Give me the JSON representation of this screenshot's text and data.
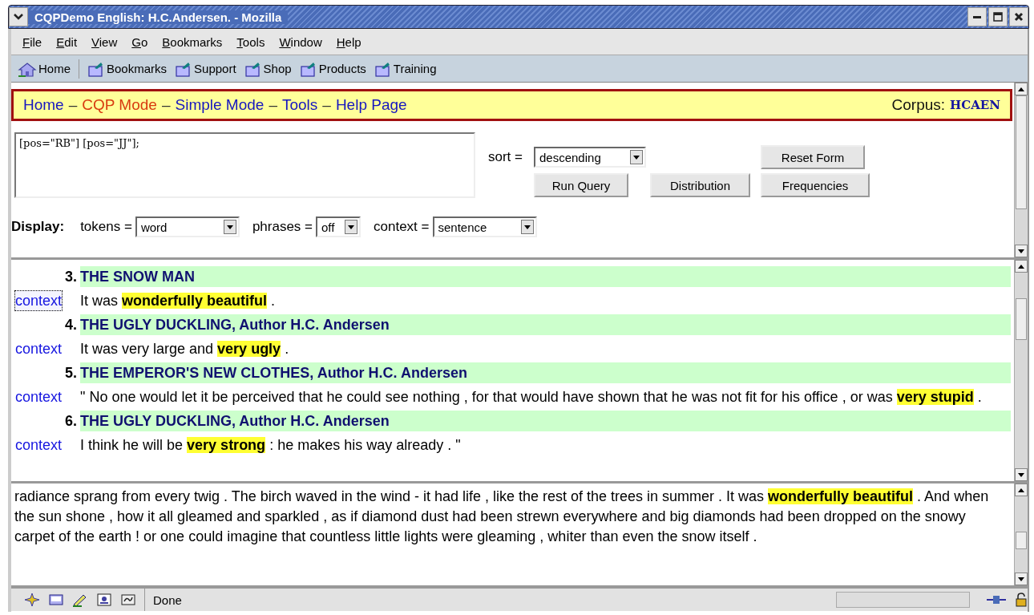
{
  "window": {
    "title": "CQPDemo English: H.C.Andersen. - Mozilla"
  },
  "menu_bar": [
    {
      "label": "File"
    },
    {
      "label": "Edit"
    },
    {
      "label": "View"
    },
    {
      "label": "Go"
    },
    {
      "label": "Bookmarks"
    },
    {
      "label": "Tools"
    },
    {
      "label": "Window"
    },
    {
      "label": "Help"
    }
  ],
  "toolbar": [
    {
      "label": "Home",
      "kind": "home"
    },
    {
      "label": "Bookmarks",
      "kind": "folder"
    },
    {
      "label": "Support",
      "kind": "folder"
    },
    {
      "label": "Shop",
      "kind": "folder"
    },
    {
      "label": "Products",
      "kind": "folder"
    },
    {
      "label": "Training",
      "kind": "folder"
    }
  ],
  "nav": {
    "items": [
      {
        "kind": "link",
        "label": "Home",
        "selected": false
      },
      {
        "kind": "separator",
        "label": "–"
      },
      {
        "kind": "link",
        "label": "CQP Mode",
        "selected": true
      },
      {
        "kind": "separator",
        "label": "–"
      },
      {
        "kind": "link",
        "label": "Simple Mode",
        "selected": false
      },
      {
        "kind": "separator",
        "label": "–"
      },
      {
        "kind": "link",
        "label": "Tools",
        "selected": false
      },
      {
        "kind": "separator",
        "label": "–"
      },
      {
        "kind": "link",
        "label": "Help Page",
        "selected": false
      }
    ],
    "corpus_label": "Corpus:",
    "corpus": "HCAEN"
  },
  "query": {
    "value": "[pos=\"RB\"] [pos=\"JJ\"];"
  },
  "sort": {
    "label": "sort =",
    "value": "descending"
  },
  "buttons": [
    "Reset Form",
    "Run Query",
    "Distribution",
    "Frequencies"
  ],
  "display": {
    "label": "Display:",
    "selects": [
      {
        "label": "tokens =",
        "value": "word"
      },
      {
        "label": "phrases =",
        "value": "off"
      },
      {
        "label": "context =",
        "value": "sentence"
      }
    ]
  },
  "results": [
    {
      "number": "3.",
      "title": "THE SNOW MAN",
      "link": "context",
      "focused": true,
      "sentence": "It was **wonderfully beautiful** ."
    },
    {
      "number": "4.",
      "title": "THE UGLY DUCKLING, Author H.C. Andersen",
      "link": "context",
      "focused": false,
      "sentence": "It was very large and **very ugly** ."
    },
    {
      "number": "5.",
      "title": "THE EMPEROR'S NEW CLOTHES, Author H.C. Andersen",
      "link": "context",
      "focused": false,
      "sentence": "\" No one would let it be perceived that he could see nothing , for that would have shown that he was not fit for his office , or was **very stupid** ."
    },
    {
      "number": "6.",
      "title": "THE UGLY DUCKLING, Author H.C. Andersen",
      "link": "context",
      "focused": false,
      "sentence": "I think he will be **very strong** : he makes his way already . \""
    }
  ],
  "context_text": "radiance sprang from every twig . The birch waved in the wind - it had life , like the rest of the trees in summer . It was **wonderfully beautiful** . And when the sun shone , how it all gleamed and sparkled , as if diamond dust had been strewn everywhere and big diamonds had been dropped on the snowy carpet of the earth ! or one could imagine that countless little lights were gleaming , whiter than even the snow itself .",
  "status_bar": {
    "text": "Done"
  }
}
